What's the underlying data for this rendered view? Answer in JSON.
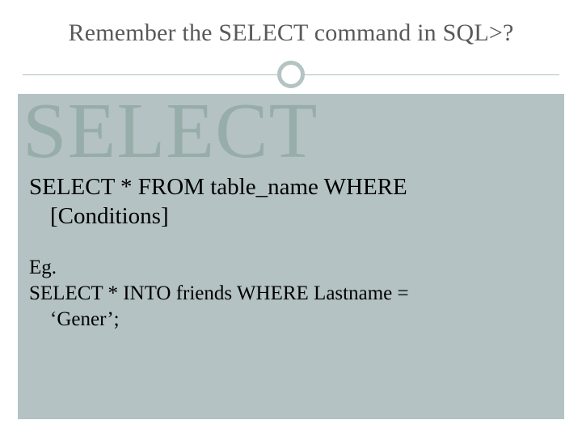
{
  "header": {
    "title": "Remember the SELECT command in SQL>?"
  },
  "content": {
    "bigword": "SELECT",
    "syntax_line1": "SELECT * FROM table_name WHERE",
    "syntax_line2": "[Conditions]",
    "eg_label": "Eg.",
    "eg_line1": "SELECT * INTO friends WHERE Lastname =",
    "eg_line2": "‘Gener’;"
  }
}
